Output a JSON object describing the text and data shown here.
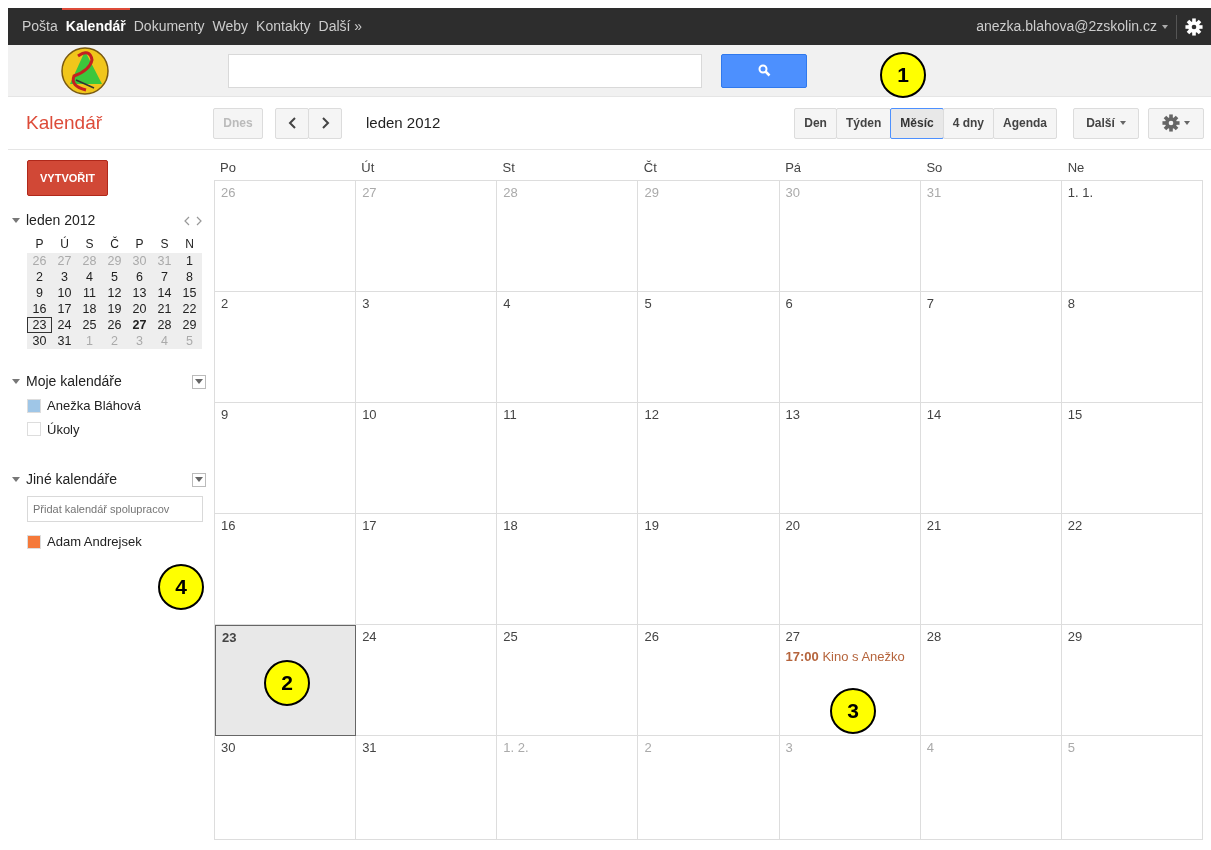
{
  "top_nav": {
    "items": [
      {
        "label": "Pošta",
        "selected": false
      },
      {
        "label": "Kalendář",
        "selected": true
      },
      {
        "label": "Dokumenty",
        "selected": false
      },
      {
        "label": "Weby",
        "selected": false
      },
      {
        "label": "Kontakty",
        "selected": false
      },
      {
        "label": "Další »",
        "selected": false
      }
    ],
    "account": "anezka.blahova@2zskolin.cz"
  },
  "app_title": "Kalendář",
  "toolbar": {
    "today_button": "Dnes",
    "period": "leden 2012",
    "views": [
      {
        "label": "Den",
        "selected": false
      },
      {
        "label": "Týden",
        "selected": false
      },
      {
        "label": "Měsíc",
        "selected": true
      },
      {
        "label": "4 dny",
        "selected": false
      },
      {
        "label": "Agenda",
        "selected": false
      }
    ],
    "more_button": "Další"
  },
  "sidebar": {
    "create_button": "VYTVOŘIT",
    "mini_calendar": {
      "title": "leden 2012",
      "weekdays": [
        "P",
        "Ú",
        "S",
        "Č",
        "P",
        "S",
        "N"
      ],
      "days": [
        {
          "label": "26",
          "muted": true,
          "today": false,
          "bold": false
        },
        {
          "label": "27",
          "muted": true,
          "today": false,
          "bold": false
        },
        {
          "label": "28",
          "muted": true,
          "today": false,
          "bold": false
        },
        {
          "label": "29",
          "muted": true,
          "today": false,
          "bold": false
        },
        {
          "label": "30",
          "muted": true,
          "today": false,
          "bold": false
        },
        {
          "label": "31",
          "muted": true,
          "today": false,
          "bold": false
        },
        {
          "label": "1",
          "muted": false,
          "today": false,
          "bold": false
        },
        {
          "label": "2",
          "muted": false,
          "today": false,
          "bold": false
        },
        {
          "label": "3",
          "muted": false,
          "today": false,
          "bold": false
        },
        {
          "label": "4",
          "muted": false,
          "today": false,
          "bold": false
        },
        {
          "label": "5",
          "muted": false,
          "today": false,
          "bold": false
        },
        {
          "label": "6",
          "muted": false,
          "today": false,
          "bold": false
        },
        {
          "label": "7",
          "muted": false,
          "today": false,
          "bold": false
        },
        {
          "label": "8",
          "muted": false,
          "today": false,
          "bold": false
        },
        {
          "label": "9",
          "muted": false,
          "today": false,
          "bold": false
        },
        {
          "label": "10",
          "muted": false,
          "today": false,
          "bold": false
        },
        {
          "label": "11",
          "muted": false,
          "today": false,
          "bold": false
        },
        {
          "label": "12",
          "muted": false,
          "today": false,
          "bold": false
        },
        {
          "label": "13",
          "muted": false,
          "today": false,
          "bold": false
        },
        {
          "label": "14",
          "muted": false,
          "today": false,
          "bold": false
        },
        {
          "label": "15",
          "muted": false,
          "today": false,
          "bold": false
        },
        {
          "label": "16",
          "muted": false,
          "today": false,
          "bold": false
        },
        {
          "label": "17",
          "muted": false,
          "today": false,
          "bold": false
        },
        {
          "label": "18",
          "muted": false,
          "today": false,
          "bold": false
        },
        {
          "label": "19",
          "muted": false,
          "today": false,
          "bold": false
        },
        {
          "label": "20",
          "muted": false,
          "today": false,
          "bold": false
        },
        {
          "label": "21",
          "muted": false,
          "today": false,
          "bold": false
        },
        {
          "label": "22",
          "muted": false,
          "today": false,
          "bold": false
        },
        {
          "label": "23",
          "muted": false,
          "today": true,
          "bold": false
        },
        {
          "label": "24",
          "muted": false,
          "today": false,
          "bold": false
        },
        {
          "label": "25",
          "muted": false,
          "today": false,
          "bold": false
        },
        {
          "label": "26",
          "muted": false,
          "today": false,
          "bold": false
        },
        {
          "label": "27",
          "muted": false,
          "today": false,
          "bold": true
        },
        {
          "label": "28",
          "muted": false,
          "today": false,
          "bold": false
        },
        {
          "label": "29",
          "muted": false,
          "today": false,
          "bold": false
        },
        {
          "label": "30",
          "muted": false,
          "today": false,
          "bold": false
        },
        {
          "label": "31",
          "muted": false,
          "today": false,
          "bold": false
        },
        {
          "label": "1",
          "muted": true,
          "today": false,
          "bold": false
        },
        {
          "label": "2",
          "muted": true,
          "today": false,
          "bold": false
        },
        {
          "label": "3",
          "muted": true,
          "today": false,
          "bold": false
        },
        {
          "label": "4",
          "muted": true,
          "today": false,
          "bold": false
        },
        {
          "label": "5",
          "muted": true,
          "today": false,
          "bold": false
        }
      ]
    },
    "sections": [
      {
        "title": "Moje kalendáře",
        "items": [
          {
            "name": "Anežka Bláhová",
            "color": "#9fc6e7"
          },
          {
            "name": "Úkoly",
            "color": "#ffffff"
          }
        ]
      },
      {
        "title": "Jiné kalendáře",
        "placeholder": "Přidat kalendář spolupracov",
        "items": [
          {
            "name": "Adam Andrejsek",
            "color": "#f5793a"
          }
        ]
      }
    ]
  },
  "month_grid": {
    "weekdays": [
      "Po",
      "Út",
      "St",
      "Čt",
      "Pá",
      "So",
      "Ne"
    ],
    "days": [
      {
        "label": "26",
        "muted": true,
        "selected": false
      },
      {
        "label": "27",
        "muted": true,
        "selected": false
      },
      {
        "label": "28",
        "muted": true,
        "selected": false
      },
      {
        "label": "29",
        "muted": true,
        "selected": false
      },
      {
        "label": "30",
        "muted": true,
        "selected": false
      },
      {
        "label": "31",
        "muted": true,
        "selected": false
      },
      {
        "label": "1. 1.",
        "muted": false,
        "selected": false
      },
      {
        "label": "2",
        "muted": false,
        "selected": false
      },
      {
        "label": "3",
        "muted": false,
        "selected": false
      },
      {
        "label": "4",
        "muted": false,
        "selected": false
      },
      {
        "label": "5",
        "muted": false,
        "selected": false
      },
      {
        "label": "6",
        "muted": false,
        "selected": false
      },
      {
        "label": "7",
        "muted": false,
        "selected": false
      },
      {
        "label": "8",
        "muted": false,
        "selected": false
      },
      {
        "label": "9",
        "muted": false,
        "selected": false
      },
      {
        "label": "10",
        "muted": false,
        "selected": false
      },
      {
        "label": "11",
        "muted": false,
        "selected": false
      },
      {
        "label": "12",
        "muted": false,
        "selected": false
      },
      {
        "label": "13",
        "muted": false,
        "selected": false
      },
      {
        "label": "14",
        "muted": false,
        "selected": false
      },
      {
        "label": "15",
        "muted": false,
        "selected": false
      },
      {
        "label": "16",
        "muted": false,
        "selected": false
      },
      {
        "label": "17",
        "muted": false,
        "selected": false
      },
      {
        "label": "18",
        "muted": false,
        "selected": false
      },
      {
        "label": "19",
        "muted": false,
        "selected": false
      },
      {
        "label": "20",
        "muted": false,
        "selected": false
      },
      {
        "label": "21",
        "muted": false,
        "selected": false
      },
      {
        "label": "22",
        "muted": false,
        "selected": false
      },
      {
        "label": "23",
        "muted": false,
        "selected": true
      },
      {
        "label": "24",
        "muted": false,
        "selected": false
      },
      {
        "label": "25",
        "muted": false,
        "selected": false
      },
      {
        "label": "26",
        "muted": false,
        "selected": false
      },
      {
        "label": "27",
        "muted": false,
        "selected": false,
        "events": [
          {
            "time": "17:00",
            "title": "Kino s Anežko"
          }
        ]
      },
      {
        "label": "28",
        "muted": false,
        "selected": false
      },
      {
        "label": "29",
        "muted": false,
        "selected": false
      },
      {
        "label": "30",
        "muted": false,
        "selected": false
      },
      {
        "label": "31",
        "muted": false,
        "selected": false
      },
      {
        "label": "1. 2.",
        "muted": true,
        "selected": false
      },
      {
        "label": "2",
        "muted": true,
        "selected": false
      },
      {
        "label": "3",
        "muted": true,
        "selected": false
      },
      {
        "label": "4",
        "muted": true,
        "selected": false
      },
      {
        "label": "5",
        "muted": true,
        "selected": false
      }
    ]
  },
  "callouts": [
    {
      "label": "1"
    },
    {
      "label": "2"
    },
    {
      "label": "3"
    },
    {
      "label": "4"
    }
  ]
}
